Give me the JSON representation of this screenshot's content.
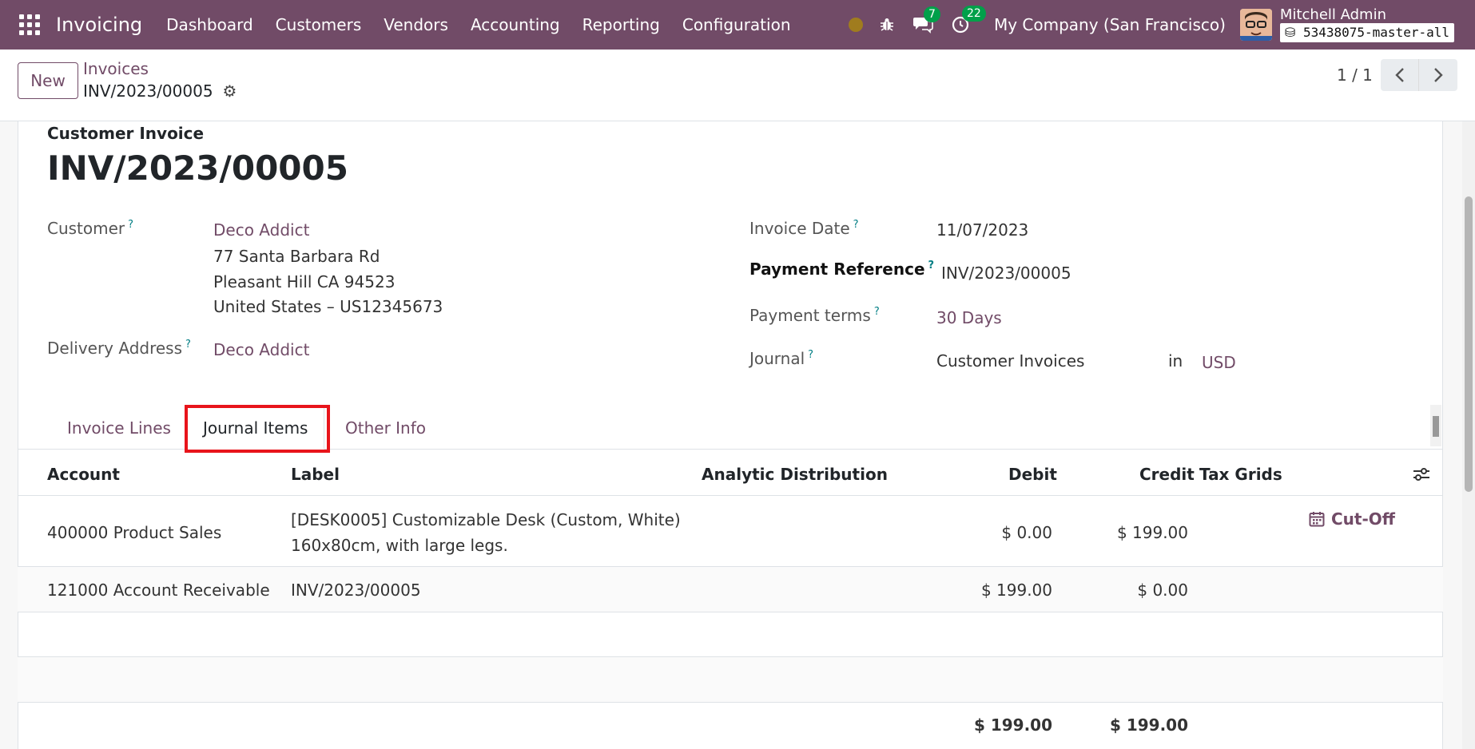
{
  "navbar": {
    "app_name": "Invoicing",
    "menu": [
      "Dashboard",
      "Customers",
      "Vendors",
      "Accounting",
      "Reporting",
      "Configuration"
    ],
    "messages_count": "7",
    "activities_count": "22",
    "company": "My Company (San Francisco)",
    "user_name": "Mitchell Admin",
    "database": "53438075-master-all",
    "color": "#714B67"
  },
  "control": {
    "new_label": "New",
    "breadcrumb_parent": "Invoices",
    "breadcrumb_current": "INV/2023/00005",
    "pager_value": "1 / 1"
  },
  "invoice": {
    "doc_type": "Customer Invoice",
    "number": "INV/2023/00005",
    "customer_label": "Customer",
    "customer_name": "Deco Addict",
    "address_line1": "77 Santa Barbara Rd",
    "address_line2": "Pleasant Hill CA 94523",
    "address_line3": "United States – US12345673",
    "delivery_label": "Delivery Address",
    "delivery_value": "Deco Addict",
    "invoice_date_label": "Invoice Date",
    "invoice_date_value": "11/07/2023",
    "payment_ref_label": "Payment Reference",
    "payment_ref_value": "INV/2023/00005",
    "payment_terms_label": "Payment terms",
    "payment_terms_value": "30 Days",
    "journal_label": "Journal",
    "journal_value": "Customer Invoices",
    "journal_in": "in",
    "currency": "USD",
    "help_mark": "?"
  },
  "tabs": [
    "Invoice Lines",
    "Journal Items",
    "Other Info"
  ],
  "table": {
    "headers": [
      "Account",
      "Label",
      "Analytic Distribution",
      "Debit",
      "Credit",
      "Tax Grids"
    ],
    "rows": [
      {
        "account": "400000 Product Sales",
        "label1": "[DESK0005] Customizable Desk (Custom, White)",
        "label2": "160x80cm, with large legs.",
        "debit": "$ 0.00",
        "credit": "$ 199.00",
        "action": "Cut-Off"
      },
      {
        "account": "121000 Account Receivable",
        "label1": "INV/2023/00005",
        "debit": "$ 199.00",
        "credit": "$ 0.00"
      }
    ],
    "total_debit": "$ 199.00",
    "total_credit": "$ 199.00"
  }
}
